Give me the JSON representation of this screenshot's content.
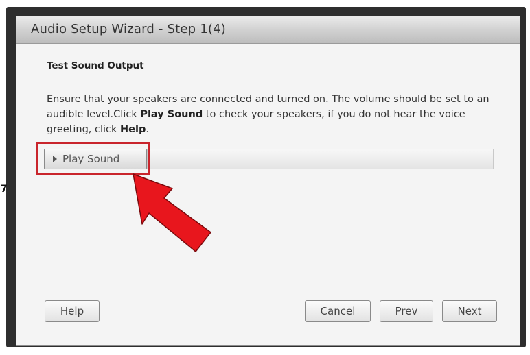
{
  "window": {
    "title": "Audio Setup Wizard - Step 1(4)"
  },
  "content": {
    "section_title": "Test Sound Output",
    "instructions": {
      "part1": "Ensure that your speakers are connected and turned on. The volume should be set to an audible level.Click ",
      "bold1": "Play Sound",
      "part2": " to check your speakers, if you do not hear the voice greeting, click ",
      "bold2": "Help",
      "part3": "."
    },
    "play_button_label": "Play Sound",
    "play_icon": "play-icon",
    "progress": {
      "value": 0
    }
  },
  "footer": {
    "help_label": "Help",
    "cancel_label": "Cancel",
    "prev_label": "Prev",
    "next_label": "Next"
  },
  "annotation": {
    "highlight_color": "#c9252c",
    "arrow_color": "#e8161d",
    "side_mark": "7"
  }
}
